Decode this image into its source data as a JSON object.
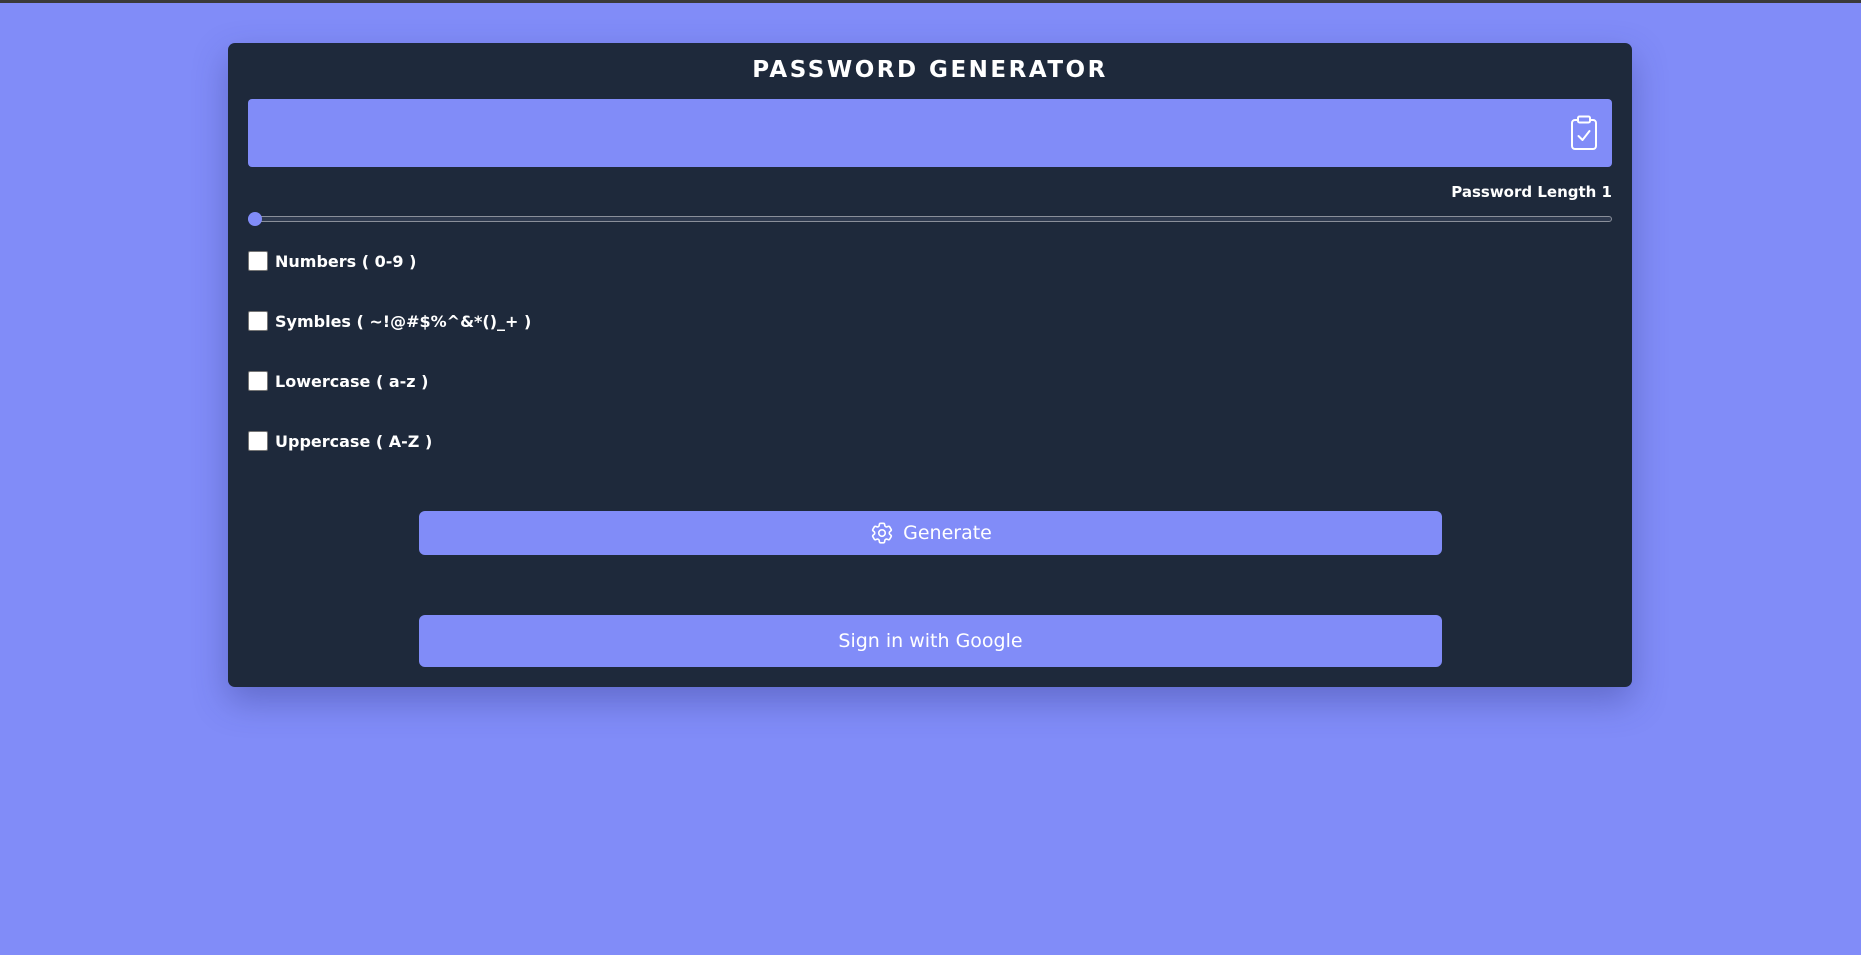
{
  "app": {
    "title": "PASSWORD GENERATOR"
  },
  "output": {
    "value": ""
  },
  "copy_button": {
    "icon": "clipboard-check-icon"
  },
  "length": {
    "label": "Password Length 1",
    "value": 1,
    "min": 1,
    "max": 50
  },
  "options": [
    {
      "label": "Numbers ( 0-9 )",
      "checked": false
    },
    {
      "label": "Symbles ( ~!@#$%^&*()_+ )",
      "checked": false
    },
    {
      "label": "Lowercase ( a-z )",
      "checked": false
    },
    {
      "label": "Uppercase ( A-Z )",
      "checked": false
    }
  ],
  "buttons": {
    "generate_label": "Generate",
    "generate_icon": "gear-icon",
    "google_label": "Sign in with Google"
  },
  "colors": {
    "background": "#818cf8",
    "card": "#1e293b",
    "accent": "#818cf8",
    "text": "#ffffff"
  }
}
